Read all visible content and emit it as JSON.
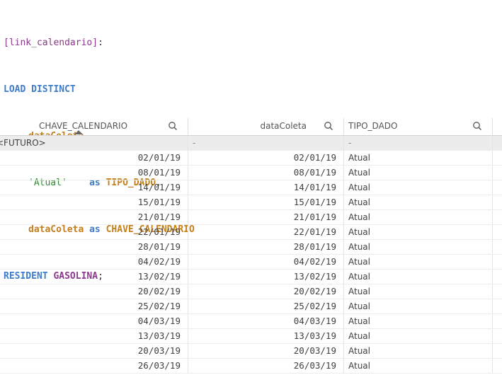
{
  "script": {
    "line1": {
      "label": "[link_calendario]",
      "colon": ":"
    },
    "line2": {
      "keyword": "LOAD DISTINCT"
    },
    "line3": {
      "field": "dataColeta",
      "comma": ","
    },
    "line4": {
      "string": "'Atual'",
      "as": "as",
      "alias": "TIPO_DADO",
      "comma": ","
    },
    "line5": {
      "field": "dataColeta",
      "as": "as",
      "alias": "CHAVE_CALENDARIO"
    },
    "line6": {
      "keyword": "RESIDENT",
      "table": "GASOLINA",
      "semi": ";"
    }
  },
  "table": {
    "headers": [
      "CHAVE_CALENDARIO",
      "dataColeta",
      "TIPO_DADO"
    ],
    "search_icon": "search-icon",
    "sort_indicator": "sort-ascending-icon",
    "special_row": {
      "chave": "<FUTURO>",
      "data": "-",
      "tipo": "-"
    },
    "rows": [
      {
        "chave": "02/01/19",
        "data": "02/01/19",
        "tipo": "Atual"
      },
      {
        "chave": "08/01/19",
        "data": "08/01/19",
        "tipo": "Atual"
      },
      {
        "chave": "14/01/19",
        "data": "14/01/19",
        "tipo": "Atual"
      },
      {
        "chave": "15/01/19",
        "data": "15/01/19",
        "tipo": "Atual"
      },
      {
        "chave": "21/01/19",
        "data": "21/01/19",
        "tipo": "Atual"
      },
      {
        "chave": "22/01/19",
        "data": "22/01/19",
        "tipo": "Atual"
      },
      {
        "chave": "28/01/19",
        "data": "28/01/19",
        "tipo": "Atual"
      },
      {
        "chave": "04/02/19",
        "data": "04/02/19",
        "tipo": "Atual"
      },
      {
        "chave": "13/02/19",
        "data": "13/02/19",
        "tipo": "Atual"
      },
      {
        "chave": "20/02/19",
        "data": "20/02/19",
        "tipo": "Atual"
      },
      {
        "chave": "25/02/19",
        "data": "25/02/19",
        "tipo": "Atual"
      },
      {
        "chave": "04/03/19",
        "data": "04/03/19",
        "tipo": "Atual"
      },
      {
        "chave": "13/03/19",
        "data": "13/03/19",
        "tipo": "Atual"
      },
      {
        "chave": "20/03/19",
        "data": "20/03/19",
        "tipo": "Atual"
      },
      {
        "chave": "26/03/19",
        "data": "26/03/19",
        "tipo": "Atual"
      }
    ]
  }
}
